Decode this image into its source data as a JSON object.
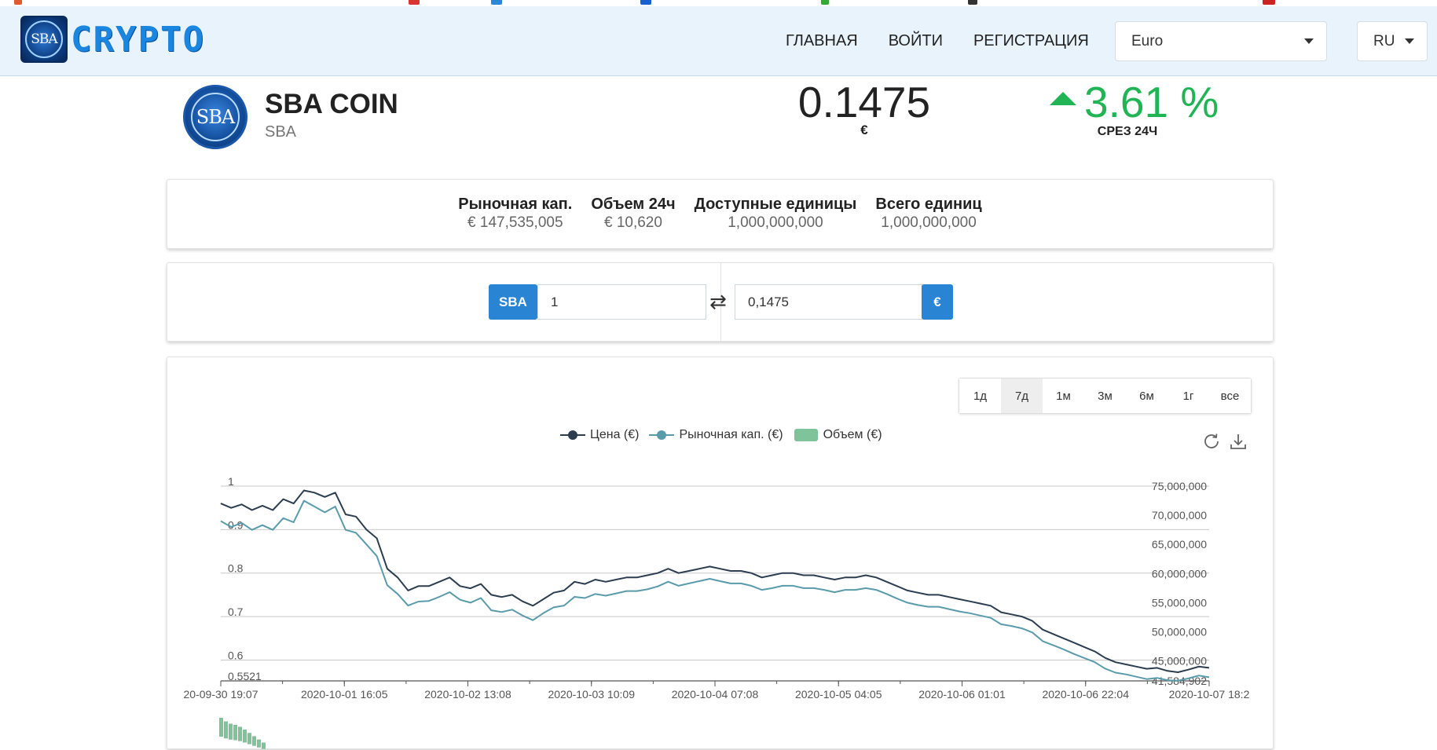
{
  "brand": {
    "logo_text": "SBA",
    "wordmark": "CRYPTO"
  },
  "nav": {
    "links": [
      "ГЛАВНАЯ",
      "ВОЙТИ",
      "РЕГИСТРАЦИЯ"
    ],
    "currency_selected": "Euro",
    "language_selected": "RU"
  },
  "coin": {
    "logo_text": "SBA",
    "name": "SBA COIN",
    "symbol": "SBA",
    "price": "0.1475",
    "price_currency": "€",
    "change": "3.61 %",
    "change_label": "СРЕЗ 24Ч",
    "change_color": "#20b455"
  },
  "stats": [
    {
      "label": "Рыночная кап.",
      "value": "€ 147,535,005"
    },
    {
      "label": "Объем 24ч",
      "value": "€ 10,620"
    },
    {
      "label": "Доступные единицы",
      "value": "1,000,000,000"
    },
    {
      "label": "Всего единиц",
      "value": "1,000,000,000"
    }
  ],
  "converter": {
    "from_tag": "SBA",
    "from_value": "1",
    "swap_icon": "⇄",
    "to_value": "0,1475",
    "to_tag": "€"
  },
  "chart": {
    "ranges": [
      "1д",
      "7д",
      "1м",
      "3м",
      "6м",
      "1г",
      "все"
    ],
    "active_range": "7д",
    "legend": [
      "Цена (€)",
      "Рыночная кап. (€)",
      "Объем (€)"
    ],
    "icons": [
      "refresh-icon",
      "download-icon"
    ]
  },
  "chart_data": {
    "type": "line",
    "legend_placement": "top",
    "grid": true,
    "series": [
      {
        "name": "Цена (€)",
        "color": "#2b3d4f",
        "axis": "left"
      },
      {
        "name": "Рыночная кап. (€)",
        "color": "#5a9bab",
        "axis": "right"
      },
      {
        "name": "Объем (€)",
        "color": "#7fc39b",
        "type": "bar"
      }
    ],
    "x_tick_labels": [
      "20-09-30 19:07",
      "2020-10-01 16:05",
      "2020-10-02 13:08",
      "2020-10-03 10:09",
      "2020-10-04 07:08",
      "2020-10-05 04:05",
      "2020-10-06 01:01",
      "2020-10-06 22:04",
      "2020-10-07 18:2"
    ],
    "y_left_ticks": [
      "1",
      "0.9",
      "0.8",
      "0.7",
      "0.6",
      "0.5521"
    ],
    "y_left_range": [
      0.5521,
      1
    ],
    "y_right_ticks": [
      "75,000,000",
      "70,000,000",
      "65,000,000",
      "60,000,000",
      "55,000,000",
      "50,000,000",
      "45,000,000",
      "41,584,902"
    ],
    "y_right_range": [
      41584902,
      75000000
    ],
    "price_values": [
      0.96,
      0.95,
      0.958,
      0.945,
      0.955,
      0.945,
      0.97,
      0.96,
      0.99,
      0.985,
      0.975,
      0.985,
      0.935,
      0.93,
      0.9,
      0.88,
      0.81,
      0.79,
      0.76,
      0.77,
      0.77,
      0.78,
      0.79,
      0.77,
      0.765,
      0.775,
      0.75,
      0.745,
      0.75,
      0.735,
      0.725,
      0.74,
      0.755,
      0.76,
      0.78,
      0.775,
      0.785,
      0.78,
      0.785,
      0.79,
      0.79,
      0.795,
      0.8,
      0.81,
      0.8,
      0.805,
      0.81,
      0.815,
      0.81,
      0.805,
      0.805,
      0.8,
      0.79,
      0.795,
      0.8,
      0.8,
      0.795,
      0.795,
      0.79,
      0.785,
      0.79,
      0.79,
      0.795,
      0.79,
      0.78,
      0.77,
      0.76,
      0.755,
      0.75,
      0.75,
      0.745,
      0.74,
      0.735,
      0.73,
      0.725,
      0.71,
      0.705,
      0.7,
      0.69,
      0.67,
      0.66,
      0.65,
      0.64,
      0.63,
      0.62,
      0.605,
      0.595,
      0.59,
      0.585,
      0.58,
      0.582,
      0.575,
      0.572,
      0.578,
      0.585,
      0.582
    ],
    "market_cap_values": [
      69000000,
      68000000,
      68700000,
      67500000,
      68300000,
      67500000,
      69500000,
      68800000,
      72500000,
      71500000,
      70500000,
      71500000,
      67500000,
      67000000,
      65000000,
      63000000,
      58000000,
      56500000,
      54500000,
      55200000,
      55300000,
      56000000,
      56800000,
      55500000,
      55000000,
      55800000,
      53700000,
      53400000,
      53800000,
      52800000,
      52000000,
      53200000,
      54200000,
      54500000,
      56000000,
      55800000,
      56500000,
      56200000,
      56600000,
      57000000,
      57000000,
      57300000,
      57800000,
      58600000,
      57900000,
      58300000,
      58700000,
      59100000,
      58700000,
      58300000,
      58300000,
      57900000,
      57200000,
      57500000,
      57900000,
      57900000,
      57500000,
      57500000,
      57200000,
      56800000,
      57200000,
      57200000,
      57500000,
      57200000,
      56500000,
      55700000,
      55000000,
      54600000,
      54300000,
      54300000,
      53900000,
      53500000,
      53200000,
      52800000,
      52400000,
      51300000,
      51000000,
      50600000,
      49900000,
      48400000,
      47700000,
      47000000,
      46200000,
      45500000,
      44800000,
      43700000,
      43000000,
      42700000,
      42300000,
      41900000,
      42100000,
      41700000,
      41600000,
      42000000,
      42500000,
      42200000
    ],
    "volume_values": [
      1200,
      1050,
      950,
      900,
      820,
      700,
      560,
      420,
      280,
      150
    ]
  }
}
